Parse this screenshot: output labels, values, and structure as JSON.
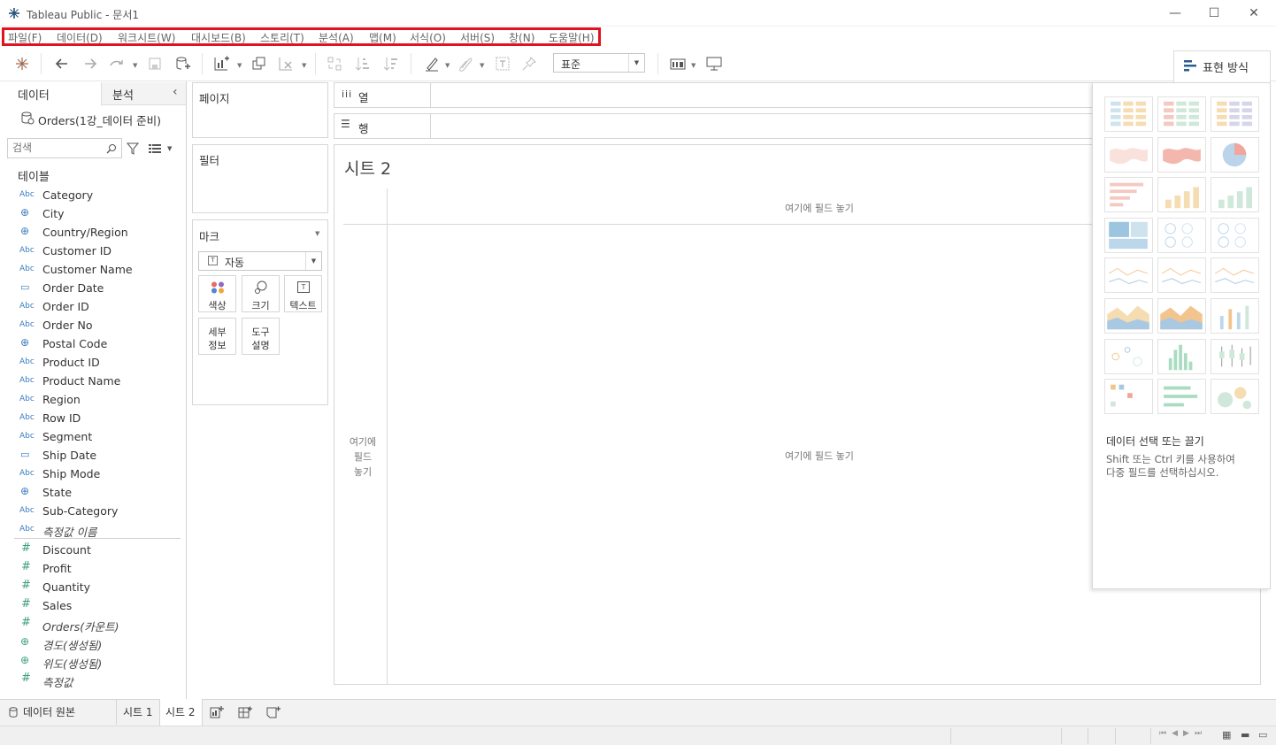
{
  "window": {
    "title": "Tableau Public - 문서1",
    "minimize": "—",
    "maximize": "☐",
    "close": "✕"
  },
  "menu": [
    {
      "label": "파일(F)"
    },
    {
      "label": "데이터(D)"
    },
    {
      "label": "워크시트(W)"
    },
    {
      "label": "대시보드(B)"
    },
    {
      "label": "스토리(T)"
    },
    {
      "label": "분석(A)"
    },
    {
      "label": "맵(M)"
    },
    {
      "label": "서식(O)"
    },
    {
      "label": "서버(S)"
    },
    {
      "label": "창(N)"
    },
    {
      "label": "도움말(H)"
    }
  ],
  "toolbar": {
    "fit_select": "표준",
    "show_me_label": "표현 방식"
  },
  "left_pane": {
    "tab_data": "데이터",
    "tab_analysis": "분석",
    "datasource": "Orders(1강_데이터 준비)",
    "search_placeholder": "검색",
    "tables_heading": "테이블",
    "dimensions": [
      {
        "type": "Abc",
        "name": "Category"
      },
      {
        "type": "geo",
        "name": "City"
      },
      {
        "type": "geo",
        "name": "Country/Region"
      },
      {
        "type": "Abc",
        "name": "Customer ID"
      },
      {
        "type": "Abc",
        "name": "Customer Name"
      },
      {
        "type": "date",
        "name": "Order Date"
      },
      {
        "type": "Abc",
        "name": "Order ID"
      },
      {
        "type": "Abc",
        "name": "Order No"
      },
      {
        "type": "geo",
        "name": "Postal Code"
      },
      {
        "type": "Abc",
        "name": "Product ID"
      },
      {
        "type": "Abc",
        "name": "Product Name"
      },
      {
        "type": "Abc",
        "name": "Region"
      },
      {
        "type": "Abc",
        "name": "Row ID"
      },
      {
        "type": "Abc",
        "name": "Segment"
      },
      {
        "type": "date",
        "name": "Ship Date"
      },
      {
        "type": "Abc",
        "name": "Ship Mode"
      },
      {
        "type": "geo",
        "name": "State"
      },
      {
        "type": "Abc",
        "name": "Sub-Category"
      },
      {
        "type": "Abc",
        "name": "측정값 이름",
        "italic": true
      }
    ],
    "measures": [
      {
        "type": "#",
        "name": "Discount"
      },
      {
        "type": "#",
        "name": "Profit"
      },
      {
        "type": "#",
        "name": "Quantity"
      },
      {
        "type": "#",
        "name": "Sales"
      },
      {
        "type": "#",
        "name": "Orders(카운트)",
        "italic": true
      },
      {
        "type": "geo",
        "name": "경도(생성됨)",
        "italic": true
      },
      {
        "type": "geo",
        "name": "위도(생성됨)",
        "italic": true
      },
      {
        "type": "#",
        "name": "측정값",
        "italic": true
      }
    ]
  },
  "shelves": {
    "pages": "페이지",
    "filters": "필터",
    "marks": "마크",
    "mark_type": "자동",
    "columns": "열",
    "rows": "행",
    "mark_buttons": {
      "color": "색상",
      "size": "크기",
      "text": "텍스트",
      "detail_line1": "세부",
      "detail_line2": "정보",
      "tooltip_line1": "도구",
      "tooltip_line2": "설명"
    }
  },
  "canvas": {
    "sheet_title": "시트 2",
    "drop_columns": "여기에 필드 놓기",
    "drop_rows_line1": "여기에",
    "drop_rows_line2": "필드",
    "drop_rows_line3": "놓기",
    "drop_main": "여기에 필드 놓기"
  },
  "show_me": {
    "hint_title": "데이터 선택 또는 끌기",
    "hint_line1": "Shift 또는 Ctrl 키를 사용하여",
    "hint_line2": "다중 필드를 선택하십시오."
  },
  "bottom_tabs": {
    "datasource": "데이터 원본",
    "sheet1": "시트 1",
    "sheet2": "시트 2"
  },
  "colors": {
    "menu_highlight": "#e0141e",
    "dimension_icon": "#3a7bbf",
    "measure_icon": "#3c9f7a"
  }
}
